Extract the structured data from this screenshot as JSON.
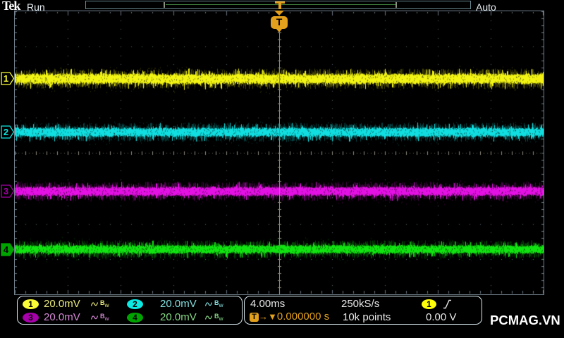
{
  "header": {
    "logo": "Tek",
    "acq_state": "Run",
    "trigger_mode": "Auto"
  },
  "trigger_marker_label": "T",
  "channels": [
    {
      "id": "1",
      "scale": "20.0mV",
      "bandwidth_label": "Bw",
      "badge_color": "#f9fb36",
      "text_color": "#e9e97e",
      "marker_filled": false
    },
    {
      "id": "2",
      "scale": "20.0mV",
      "bandwidth_label": "Bw",
      "badge_color": "#0ce8e2",
      "text_color": "#83dede",
      "marker_filled": false
    },
    {
      "id": "3",
      "scale": "20.0mV",
      "bandwidth_label": "Bw",
      "badge_color": "#a800aa",
      "text_color": "#d889d8",
      "marker_filled": false
    },
    {
      "id": "4",
      "scale": "20.0mV",
      "bandwidth_label": "Bw",
      "badge_color": "#00a400",
      "text_color": "#83d883",
      "marker_filled": true
    }
  ],
  "horizontal": {
    "time_per_div": "4.00ms",
    "sample_rate": "250kS/s",
    "record_length": "10k points",
    "trigger_position": "0.000000 s"
  },
  "trigger": {
    "source": "1",
    "level": "0.00 V",
    "slope": "rising",
    "source_badge_color": "#ffff0a"
  },
  "watermark": "PCMAG.VN",
  "colors": {
    "trace_ch1": "#f2f414",
    "trace_ch1_dim": "#6e6f08",
    "trace_ch2": "#12dee0",
    "trace_ch2_dim": "#0a6e6e",
    "trace_ch3": "#e312e3",
    "trace_ch3_dim": "#6e0a6e",
    "trace_ch4": "#12e312",
    "trace_ch4_dim": "#086e08",
    "orange": "#e2a01c",
    "grid_dot": "#5a6670",
    "grid_tick": "#8f8d80",
    "edge_tick": "#6b7680",
    "frame": "#72828e",
    "trigger_line": "#85867e",
    "record_line": "#3d7b3c"
  },
  "chart_data": {
    "type": "line",
    "title": "Four-channel oscilloscope noise traces",
    "x_axis": {
      "time_per_div_s": 0.004,
      "divisions": 10,
      "trigger_position_s": 0.0
    },
    "y_axis": {
      "divisions": 8
    },
    "series": [
      {
        "name": "CH1",
        "volts_per_div_V": 0.02,
        "offset_div": 2.09,
        "mean_V": 0.0,
        "noise_core_div": 0.16,
        "noise_peak_div": 0.29,
        "seed": 11
      },
      {
        "name": "CH2",
        "volts_per_div_V": 0.02,
        "offset_div": 0.58,
        "mean_V": 0.0,
        "noise_core_div": 0.14,
        "noise_peak_div": 0.27,
        "seed": 22
      },
      {
        "name": "CH3",
        "volts_per_div_V": 0.02,
        "offset_div": -1.09,
        "mean_V": 0.0,
        "noise_core_div": 0.14,
        "noise_peak_div": 0.27,
        "seed": 33
      },
      {
        "name": "CH4",
        "volts_per_div_V": 0.02,
        "offset_div": -2.73,
        "mean_V": 0.0,
        "noise_core_div": 0.13,
        "noise_peak_div": 0.26,
        "seed": 44
      }
    ]
  }
}
